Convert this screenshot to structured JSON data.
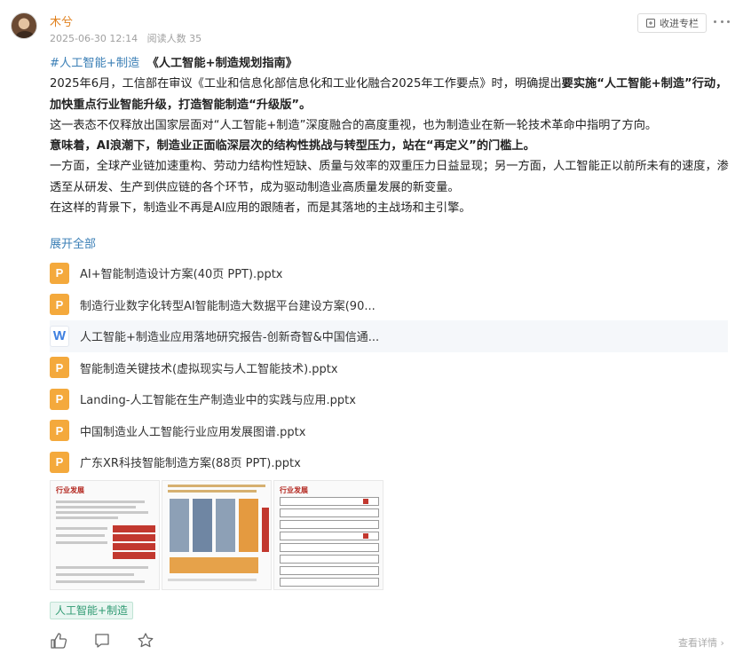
{
  "post": {
    "author": "木兮",
    "date": "2025-06-30 12:14",
    "reads": "阅读人数 35",
    "collect_label": "收进专栏"
  },
  "content": {
    "topic": "#人工智能+制造",
    "title": "《人工智能+制造规划指南》",
    "p1_a": "2025年6月，工信部在审议《工业和信息化部信息化和工业化融合2025年工作要点》时，明确提出",
    "p1_b": "要实施“人工智能+制造”行动，加快重点行业智能升级，打造智能制造“升级版”。",
    "p2": "这一表态不仅释放出国家层面对“人工智能+制造”深度融合的高度重视，也为制造业在新一轮技术革命中指明了方向。",
    "p3_a": "意味着，",
    "p3_b": "AI浪潮下，制造业正面临深层次的结构性挑战与转型压力，站在“再定义”的门槛上。",
    "p4": "一方面，全球产业链加速重构、劳动力结构性短缺、质量与效率的双重压力日益显现；另一方面，人工智能正以前所未有的速度，渗透至从研发、生产到供应链的各个环节，成为驱动制造业高质量发展的新变量。",
    "p5": "在这样的背景下，制造业不再是AI应用的跟随者，而是其落地的主战场和主引擎。",
    "expand_label": "展开全部"
  },
  "files": [
    {
      "name": "AI+智能制造设计方案(40页 PPT).pptx",
      "type": "ppt"
    },
    {
      "name": "制造行业数字化转型AI智能制造大数据平台建设方案(90...",
      "type": "ppt"
    },
    {
      "name": "人工智能+制造业应用落地研究报告-创新奇智&中国信通...",
      "type": "word"
    },
    {
      "name": "智能制造关键技术(虚拟现实与人工智能技术).pptx",
      "type": "ppt"
    },
    {
      "name": "Landing-人工智能在生产制造业中的实践与应用.pptx",
      "type": "ppt"
    },
    {
      "name": "中国制造业人工智能行业应用发展图谱.pptx",
      "type": "ppt"
    },
    {
      "name": "广东XR科技智能制造方案(88页 PPT).pptx",
      "type": "ppt"
    }
  ],
  "thumbs": {
    "t1_title": "行业发展",
    "t3_title": "行业发展"
  },
  "tag": "人工智能+制造",
  "footer": {
    "details_label": "查看详情"
  },
  "icons": {
    "ppt": "P",
    "word": "W"
  }
}
